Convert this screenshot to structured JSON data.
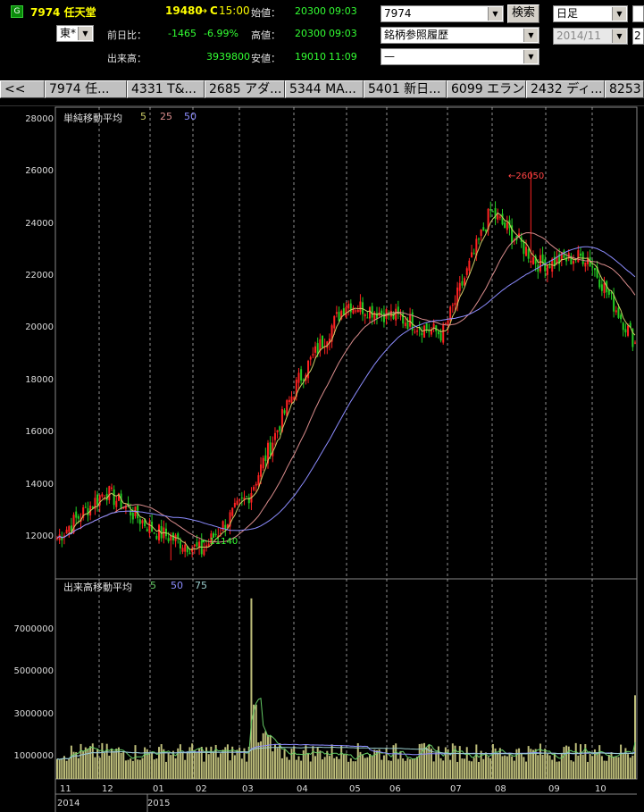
{
  "header": {
    "badge": "G",
    "stock_title": "7974 任天堂",
    "last_price": "19480",
    "price_arrow": "→",
    "price_flag": "C",
    "price_time": "15:00",
    "market_select": "東*",
    "change_label": "前日比：",
    "change_value": "-1465",
    "change_pct": "-6.99%",
    "volume_label": "出来高：",
    "volume_value": "3939800",
    "open_label": "始値：",
    "open_value": "20300",
    "open_time": "09:03",
    "high_label": "高値：",
    "high_value": "20300",
    "high_time": "09:03",
    "low_label": "安値：",
    "low_value": "19010",
    "low_time": "11:09"
  },
  "search": {
    "code_value": "7974",
    "search_button": "検索",
    "history_select": "銘柄参照履歴",
    "third_select": "—"
  },
  "period": {
    "period_select": "日足",
    "date_select": "2014/11",
    "next_cut": "2"
  },
  "tabs": [
    {
      "label": "<<"
    },
    {
      "label": "7974 任..."
    },
    {
      "label": "4331 T&..."
    },
    {
      "label": "2685 アダ..."
    },
    {
      "label": "5344 MA..."
    },
    {
      "label": "5401 新日..."
    },
    {
      "label": "6099 エラン"
    },
    {
      "label": "2432 ディ..."
    },
    {
      "label": "8253"
    }
  ],
  "price_panel": {
    "legend_title": "単純移動平均",
    "legend_ma": [
      "5",
      "25",
      "50"
    ],
    "legend_colors": [
      "#cccc66",
      "#d98c8c",
      "#8c8cff"
    ],
    "y_ticks": [
      "28000",
      "26000",
      "24000",
      "22000",
      "20000",
      "18000",
      "16000",
      "14000",
      "12000"
    ],
    "high_marker": "←26050",
    "low_marker": "←11140"
  },
  "volume_panel": {
    "legend_title": "出来高移動平均",
    "legend_ma": [
      "5",
      "50",
      "75"
    ],
    "legend_colors": [
      "#66cc66",
      "#8c8cff",
      "#99cccc"
    ],
    "y_ticks": [
      "7000000",
      "5000000",
      "3000000",
      "1000000"
    ]
  },
  "x_axis": {
    "months": [
      "11",
      "12",
      "01",
      "02",
      "03",
      "04",
      "05",
      "06",
      "07",
      "08",
      "09",
      "10"
    ],
    "years": [
      "2014",
      "2015"
    ]
  },
  "chart_data": {
    "type": "candlestick",
    "x": [
      "2014-11",
      "2014-12",
      "2015-01",
      "2015-02",
      "2015-03",
      "2015-04",
      "2015-05",
      "2015-06",
      "2015-07",
      "2015-08",
      "2015-09",
      "2015-10"
    ],
    "ylim_price": [
      10500,
      28500
    ],
    "ylim_volume": [
      0,
      9000000
    ],
    "series_close_approx": [
      12000,
      13800,
      12300,
      11500,
      13700,
      18000,
      21000,
      20500,
      19800,
      24500,
      22500,
      22800,
      19480
    ],
    "high": 26050,
    "low": 11140,
    "last_close": 19480,
    "max_volume_approx": 8500000
  }
}
